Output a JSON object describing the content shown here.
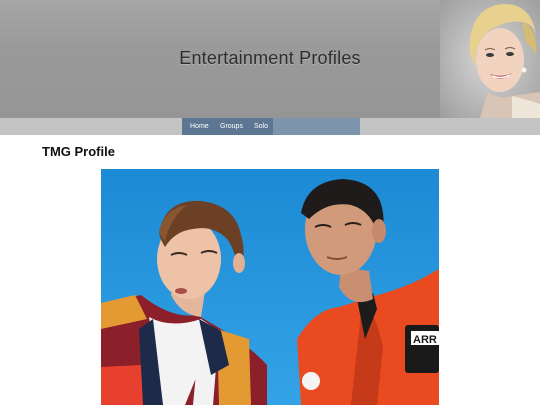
{
  "header": {
    "title": "Entertainment Profiles"
  },
  "nav": {
    "items": [
      {
        "label": "Home"
      },
      {
        "label": "Groups"
      },
      {
        "label": "Solo"
      }
    ]
  },
  "main": {
    "title": "TMG Profile"
  },
  "colors": {
    "banner": "#9a9a9a",
    "navbar": "#c4c4c4",
    "nav_box": "#7d94ad",
    "nav_active": "#5d7792",
    "sky": "#1f8fd6"
  },
  "icons": {
    "portrait": "woman-portrait-image",
    "photo": "duo-band-photo"
  }
}
